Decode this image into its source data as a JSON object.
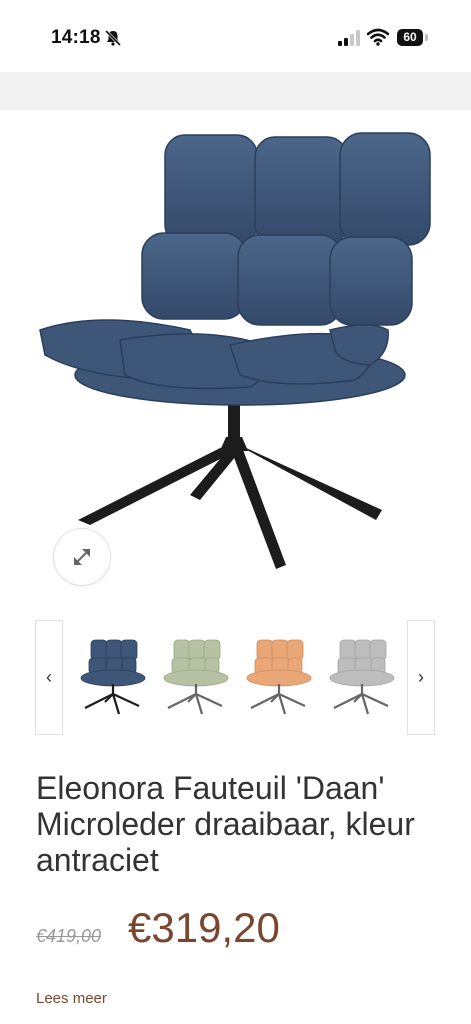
{
  "status_bar": {
    "time": "14:18",
    "battery": "60",
    "icons": [
      "bell-slash-icon",
      "signal-icon",
      "wifi-icon",
      "battery-icon"
    ]
  },
  "product": {
    "title": "Eleonora Fauteuil 'Daan' Microleder draaibaar, kleur antraciet",
    "old_price": "€419,00",
    "price": "€319,20",
    "read_more": "Lees meer",
    "main_color": "#3e5778",
    "thumbnail_colors": [
      {
        "name": "blue",
        "hex": "#3e5778"
      },
      {
        "name": "sage",
        "hex": "#b7c2a3"
      },
      {
        "name": "orange",
        "hex": "#e9a777"
      },
      {
        "name": "grey",
        "hex": "#bdbdbd"
      }
    ]
  },
  "colors": {
    "price": "#7a4630",
    "leg": "#1c1c1c"
  },
  "gallery": {
    "prev_label": "‹",
    "next_label": "›"
  }
}
